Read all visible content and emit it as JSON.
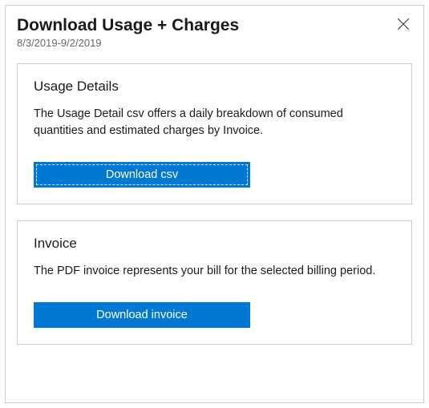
{
  "header": {
    "title": "Download Usage + Charges",
    "date_range": "8/3/2019-9/2/2019"
  },
  "usage_card": {
    "title": "Usage Details",
    "description": "The Usage Detail csv offers a daily breakdown of consumed quantities and estimated charges by Invoice.",
    "button_label": "Download csv"
  },
  "invoice_card": {
    "title": "Invoice",
    "description": "The PDF invoice represents your bill for the selected billing period.",
    "button_label": "Download invoice"
  },
  "colors": {
    "primary": "#0078d4",
    "border": "#cccccc"
  }
}
